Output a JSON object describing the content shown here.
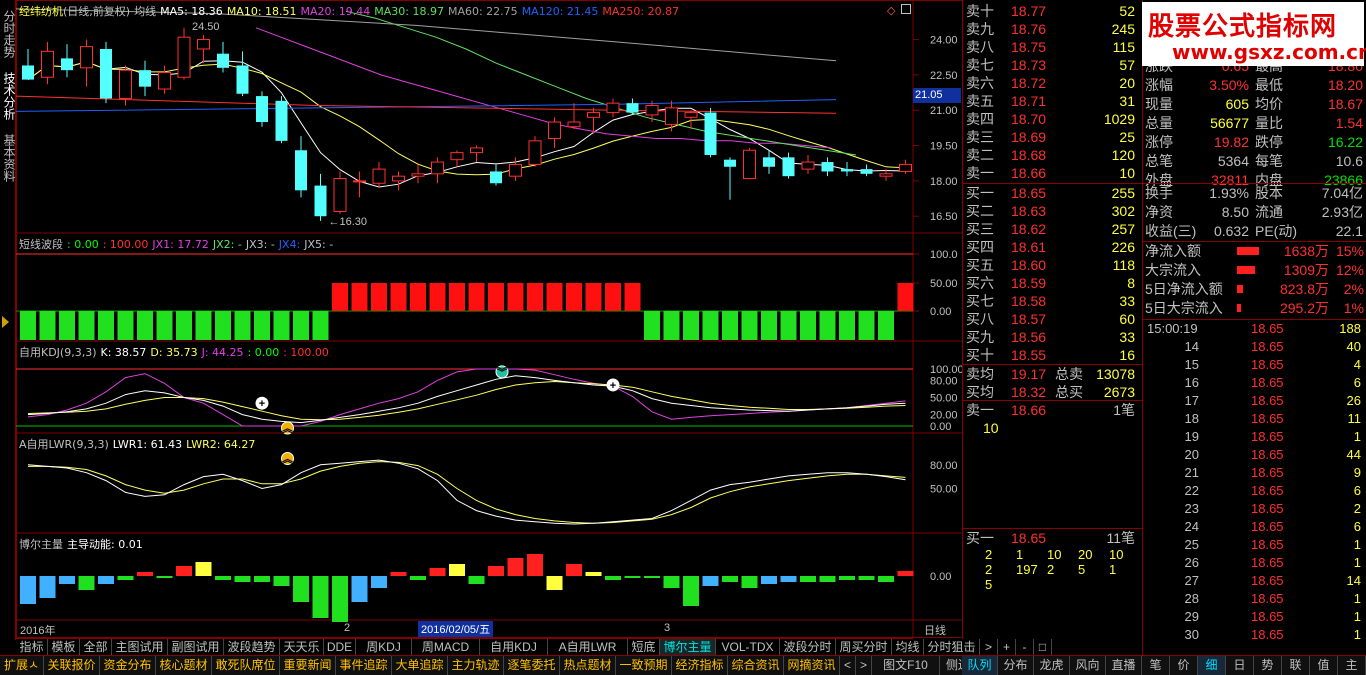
{
  "left_tabs": [
    "分时走势",
    "技术分析",
    "基本资料"
  ],
  "main_title": {
    "stock": "经纬纺机",
    "mode": "(日线,前复权)",
    "ma_label": "均线",
    "mas": [
      {
        "label": "MA5: 18.36",
        "color": "#ffffff"
      },
      {
        "label": "MA10: 18.51",
        "color": "#ffff60"
      },
      {
        "label": "MA20: 19.44",
        "color": "#e040e0"
      },
      {
        "label": "MA30: 18.97",
        "color": "#60e060"
      },
      {
        "label": "MA60: 22.75",
        "color": "#a0a0a0"
      },
      {
        "label": "MA120: 21.45",
        "color": "#2060ff"
      },
      {
        "label": "MA250: 20.87",
        "color": "#ff3030"
      }
    ]
  },
  "price_axis": [
    "24.00",
    "22.50",
    "21.00",
    "19.50",
    "18.00",
    "16.50"
  ],
  "price_marker": "21.05",
  "annotations": {
    "high": "24.50",
    "low": "16.30"
  },
  "panel_wave": {
    "title": "短线波段",
    "values": [
      {
        "label": ": 0.00",
        "color": "#00ff00"
      },
      {
        "label": ": 100.00",
        "color": "#ff3030"
      },
      {
        "label": "JX1: 17.72",
        "color": "#e040e0"
      },
      {
        "label": "JX2: -",
        "color": "#60e060"
      },
      {
        "label": "JX3: -",
        "color": "#c0c0c0"
      },
      {
        "label": "JX4:",
        "color": "#2060ff"
      },
      {
        "label": "JX5: -",
        "color": "#c0c0c0"
      }
    ],
    "axis": [
      "100.0",
      "50.00",
      "0.00"
    ]
  },
  "panel_kdj": {
    "title": "自用KDJ(9,3,3)",
    "values": [
      {
        "label": "K: 38.57",
        "color": "#ffffff"
      },
      {
        "label": "D: 35.73",
        "color": "#ffff60"
      },
      {
        "label": "J: 44.25",
        "color": "#e040e0"
      },
      {
        "label": ": 0.00",
        "color": "#00ff00"
      },
      {
        "label": ": 100.00",
        "color": "#ff3030"
      }
    ],
    "axis": [
      "100.00",
      "80.00",
      "50.00",
      "20.00",
      "0.00"
    ]
  },
  "panel_lwr": {
    "title": "A自用LWR(9,3,3)",
    "values": [
      {
        "label": "LWR1: 61.43",
        "color": "#ffffff"
      },
      {
        "label": "LWR2: 64.27",
        "color": "#ffff60"
      }
    ],
    "axis": [
      "80.00",
      "50.00"
    ]
  },
  "panel_bo": {
    "title": "博尔主量",
    "values": [
      {
        "label": "主导动能: 0.01",
        "color": "#ffffff"
      }
    ],
    "axis": [
      "0.00"
    ]
  },
  "date_axis": {
    "year": "2016年",
    "m2": "2",
    "cursor": "2016/02/05/五",
    "m3": "3",
    "period": "日线"
  },
  "chart_data": {
    "type": "candlestick",
    "title": "经纬纺机(日线,前复权)",
    "dates_start": "2016年",
    "candles": [
      {
        "o": 22.9,
        "h": 23.6,
        "l": 22.3,
        "c": 22.3
      },
      {
        "o": 22.4,
        "h": 23.9,
        "l": 22.1,
        "c": 23.5
      },
      {
        "o": 23.2,
        "h": 23.8,
        "l": 22.4,
        "c": 22.7
      },
      {
        "o": 22.8,
        "h": 24.0,
        "l": 22.0,
        "c": 23.7
      },
      {
        "o": 23.6,
        "h": 23.9,
        "l": 21.3,
        "c": 21.5
      },
      {
        "o": 21.5,
        "h": 22.9,
        "l": 21.2,
        "c": 22.7
      },
      {
        "o": 22.7,
        "h": 23.1,
        "l": 21.6,
        "c": 22.0
      },
      {
        "o": 21.9,
        "h": 22.9,
        "l": 21.7,
        "c": 22.6
      },
      {
        "o": 22.4,
        "h": 24.5,
        "l": 22.3,
        "c": 24.1
      },
      {
        "o": 23.6,
        "h": 24.2,
        "l": 23.0,
        "c": 24.0
      },
      {
        "o": 23.4,
        "h": 23.9,
        "l": 22.6,
        "c": 22.8
      },
      {
        "o": 22.9,
        "h": 23.5,
        "l": 21.6,
        "c": 21.7
      },
      {
        "o": 21.6,
        "h": 21.8,
        "l": 20.3,
        "c": 20.5
      },
      {
        "o": 21.4,
        "h": 21.6,
        "l": 19.6,
        "c": 19.7
      },
      {
        "o": 19.3,
        "h": 19.9,
        "l": 17.3,
        "c": 17.6
      },
      {
        "o": 17.8,
        "h": 18.3,
        "l": 16.3,
        "c": 16.5
      },
      {
        "o": 16.7,
        "h": 18.4,
        "l": 16.6,
        "c": 18.1
      },
      {
        "o": 18.0,
        "h": 18.4,
        "l": 17.3,
        "c": 18.0
      },
      {
        "o": 17.9,
        "h": 18.8,
        "l": 17.7,
        "c": 18.5
      },
      {
        "o": 18.0,
        "h": 18.4,
        "l": 17.6,
        "c": 18.2
      },
      {
        "o": 18.2,
        "h": 18.7,
        "l": 17.9,
        "c": 18.3
      },
      {
        "o": 18.3,
        "h": 19.0,
        "l": 17.9,
        "c": 18.8
      },
      {
        "o": 18.9,
        "h": 19.3,
        "l": 18.6,
        "c": 19.2
      },
      {
        "o": 19.2,
        "h": 19.5,
        "l": 18.8,
        "c": 19.4
      },
      {
        "o": 18.4,
        "h": 18.7,
        "l": 17.8,
        "c": 17.9
      },
      {
        "o": 18.2,
        "h": 19.0,
        "l": 18.0,
        "c": 18.7
      },
      {
        "o": 18.7,
        "h": 19.9,
        "l": 18.6,
        "c": 19.7
      },
      {
        "o": 19.8,
        "h": 20.7,
        "l": 19.4,
        "c": 20.5
      },
      {
        "o": 20.3,
        "h": 21.3,
        "l": 20.2,
        "c": 20.5
      },
      {
        "o": 20.7,
        "h": 21.1,
        "l": 20.0,
        "c": 20.9
      },
      {
        "o": 20.9,
        "h": 21.5,
        "l": 20.7,
        "c": 21.3
      },
      {
        "o": 21.3,
        "h": 21.5,
        "l": 20.8,
        "c": 20.9
      },
      {
        "o": 20.8,
        "h": 21.4,
        "l": 20.5,
        "c": 21.2
      },
      {
        "o": 20.4,
        "h": 21.4,
        "l": 20.1,
        "c": 21.1
      },
      {
        "o": 20.7,
        "h": 21.0,
        "l": 20.2,
        "c": 20.9
      },
      {
        "o": 20.9,
        "h": 21.1,
        "l": 19.0,
        "c": 19.1
      },
      {
        "o": 18.9,
        "h": 19.0,
        "l": 17.2,
        "c": 18.6
      },
      {
        "o": 18.1,
        "h": 19.4,
        "l": 18.1,
        "c": 19.3
      },
      {
        "o": 19.0,
        "h": 19.3,
        "l": 18.3,
        "c": 18.6
      },
      {
        "o": 19.0,
        "h": 19.2,
        "l": 18.1,
        "c": 18.2
      },
      {
        "o": 18.5,
        "h": 19.1,
        "l": 18.3,
        "c": 18.8
      },
      {
        "o": 18.8,
        "h": 19.0,
        "l": 18.2,
        "c": 18.4
      },
      {
        "o": 18.5,
        "h": 18.8,
        "l": 18.2,
        "c": 18.4
      },
      {
        "o": 18.5,
        "h": 18.7,
        "l": 18.2,
        "c": 18.3
      },
      {
        "o": 18.2,
        "h": 18.5,
        "l": 18.0,
        "c": 18.3
      },
      {
        "o": 18.4,
        "h": 18.9,
        "l": 18.3,
        "c": 18.7
      }
    ],
    "ylim": [
      16.0,
      25.0
    ]
  },
  "order_book": {
    "sell": [
      {
        "n": "卖十",
        "p": "18.77",
        "v": "52"
      },
      {
        "n": "卖九",
        "p": "18.76",
        "v": "245"
      },
      {
        "n": "卖八",
        "p": "18.75",
        "v": "115"
      },
      {
        "n": "卖七",
        "p": "18.73",
        "v": "57"
      },
      {
        "n": "卖六",
        "p": "18.72",
        "v": "20"
      },
      {
        "n": "卖五",
        "p": "18.71",
        "v": "31"
      },
      {
        "n": "卖四",
        "p": "18.70",
        "v": "1029"
      },
      {
        "n": "卖三",
        "p": "18.69",
        "v": "25"
      },
      {
        "n": "卖二",
        "p": "18.68",
        "v": "120"
      },
      {
        "n": "卖一",
        "p": "18.66",
        "v": "10"
      }
    ],
    "buy": [
      {
        "n": "买一",
        "p": "18.65",
        "v": "255"
      },
      {
        "n": "买二",
        "p": "18.63",
        "v": "302"
      },
      {
        "n": "买三",
        "p": "18.62",
        "v": "257"
      },
      {
        "n": "买四",
        "p": "18.61",
        "v": "226"
      },
      {
        "n": "买五",
        "p": "18.60",
        "v": "118"
      },
      {
        "n": "买六",
        "p": "18.59",
        "v": "8"
      },
      {
        "n": "买七",
        "p": "18.58",
        "v": "33"
      },
      {
        "n": "买八",
        "p": "18.57",
        "v": "60"
      },
      {
        "n": "买九",
        "p": "18.56",
        "v": "33"
      },
      {
        "n": "买十",
        "p": "18.55",
        "v": "16"
      }
    ],
    "avg_sell": {
      "n": "卖均",
      "p": "19.17",
      "l": "总卖",
      "v": "13078"
    },
    "avg_buy": {
      "n": "买均",
      "p": "18.32",
      "l": "总买",
      "v": "2673"
    },
    "sell1_detail": {
      "n": "卖一",
      "p": "18.66",
      "v": "1笔",
      "q": "10"
    },
    "buy1_detail": {
      "n": "买一",
      "p": "18.65",
      "v": "11笔"
    },
    "buy_queue": [
      [
        "2",
        "1",
        "10",
        "20",
        "10"
      ],
      [
        "2",
        "197",
        "2",
        "5",
        "1"
      ],
      [
        "5"
      ]
    ]
  },
  "logo": {
    "title": "股票公式指标网",
    "url": "www.gsxz.com.cn"
  },
  "quote": {
    "rows": [
      {
        "l": "涨跌",
        "a": "0.65",
        "ac": "#ff3030",
        "l2": "最高",
        "b": "18.80",
        "bc": "#ff3030"
      },
      {
        "l": "涨幅",
        "a": "3.50%",
        "ac": "#ff3030",
        "l2": "最低",
        "b": "18.20",
        "bc": "#ff3030"
      },
      {
        "l": "现量",
        "a": "605",
        "ac": "#ffff40",
        "l2": "均价",
        "b": "18.67",
        "bc": "#ff3030"
      },
      {
        "l": "总量",
        "a": "56677",
        "ac": "#ffff40",
        "l2": "量比",
        "b": "1.54",
        "bc": "#ff3030"
      },
      {
        "l": "涨停",
        "a": "19.82",
        "ac": "#ff3030",
        "l2": "跌停",
        "b": "16.22",
        "bc": "#00e000"
      },
      {
        "l": "总笔",
        "a": "5364",
        "ac": "#c0c0c0",
        "l2": "每笔",
        "b": "10.6",
        "bc": "#c0c0c0"
      },
      {
        "l": "外盘",
        "a": "32811",
        "ac": "#ff3030",
        "l2": "内盘",
        "b": "23866",
        "bc": "#00e000"
      }
    ],
    "rows2": [
      {
        "l": "换手",
        "a": "1.93%",
        "ac": "#c0c0c0",
        "l2": "股本",
        "b": "7.04亿",
        "bc": "#c0c0c0"
      },
      {
        "l": "净资",
        "a": "8.50",
        "ac": "#c0c0c0",
        "l2": "流通",
        "b": "2.93亿",
        "bc": "#c0c0c0"
      },
      {
        "l": "收益(三)",
        "a": "0.632",
        "ac": "#c0c0c0",
        "l2": "PE(动)",
        "b": "22.1",
        "bc": "#c0c0c0"
      }
    ],
    "flows": [
      {
        "l": "净流入额",
        "v": "1638万",
        "pct": "15%",
        "bar": 0.9
      },
      {
        "l": "大宗流入",
        "v": "1309万",
        "pct": "12%",
        "bar": 0.72
      },
      {
        "l": "5日净流入额",
        "v": "823.8万",
        "pct": "2%",
        "bar": 0.18
      },
      {
        "l": "5日大宗流入",
        "v": "295.2万",
        "pct": "1%",
        "bar": 0.08
      }
    ]
  },
  "ticks": [
    {
      "t": "15:00:19",
      "p": "18.65",
      "v": "188"
    },
    {
      "t": "14",
      "p": "18.65",
      "v": "40"
    },
    {
      "t": "15",
      "p": "18.65",
      "v": "4"
    },
    {
      "t": "16",
      "p": "18.65",
      "v": "6"
    },
    {
      "t": "17",
      "p": "18.65",
      "v": "26"
    },
    {
      "t": "18",
      "p": "18.65",
      "v": "11"
    },
    {
      "t": "19",
      "p": "18.65",
      "v": "1"
    },
    {
      "t": "20",
      "p": "18.65",
      "v": "44"
    },
    {
      "t": "21",
      "p": "18.65",
      "v": "9"
    },
    {
      "t": "22",
      "p": "18.65",
      "v": "6"
    },
    {
      "t": "23",
      "p": "18.65",
      "v": "2"
    },
    {
      "t": "24",
      "p": "18.65",
      "v": "6"
    },
    {
      "t": "25",
      "p": "18.65",
      "v": "1"
    },
    {
      "t": "26",
      "p": "18.65",
      "v": "1"
    },
    {
      "t": "27",
      "p": "18.65",
      "v": "14"
    },
    {
      "t": "28",
      "p": "18.65",
      "v": "1"
    },
    {
      "t": "29",
      "p": "18.65",
      "v": "1"
    },
    {
      "t": "30",
      "p": "18.65",
      "v": "1"
    }
  ],
  "formula_tabs": [
    "指标",
    "模板",
    "全部",
    "主图试用",
    "副图试用",
    "波段趋势",
    "天天乐",
    "DDE",
    "周KDJ",
    "周MACD",
    "自用KDJ",
    "A自用LWR",
    "短底",
    "博尔主量",
    "VOL-TDX",
    "波段分时",
    "周买分时",
    "均线",
    "分时狙击",
    ">",
    "+",
    "-",
    "□"
  ],
  "formula_active": "博尔主量",
  "bottom_tabs": [
    "扩展ㅅ",
    "关联报价",
    "资金分布",
    "核心题材",
    "敢死队席位",
    "重要新闻",
    "事件追踪",
    "大单追踪",
    "主力轨迹",
    "逐笔委托",
    "热点题材",
    "一致预期",
    "经济指标",
    "综合资讯",
    "网摘资讯",
    "<",
    ">",
    "图文F10",
    "侧边栏<"
  ],
  "right_tabs": [
    "队列",
    "分布",
    "龙虎",
    "风向",
    "直播",
    "笔",
    "价",
    "细",
    "日",
    "势",
    "联",
    "值",
    "主"
  ],
  "right_active": "队列",
  "right_active2": "细"
}
